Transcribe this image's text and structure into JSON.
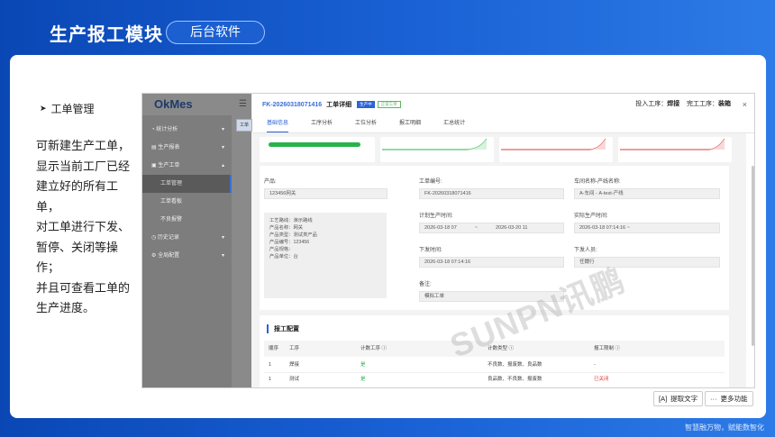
{
  "header": {
    "title": "生产报工模块",
    "pill": "后台软件"
  },
  "footer": "智慧融万物，赋能数智化",
  "section": {
    "heading": "工单管理",
    "desc": [
      "可新建生产工单，",
      "显示当前工厂已经",
      "建立好的所有工单，",
      "对工单进行下发、",
      "暂停、关闭等操作；",
      "并且可查看工单的",
      "生产进度。"
    ]
  },
  "app": {
    "logo": "OkMes",
    "menu_icon": "☰",
    "bg_tab": "工单",
    "sidebar": [
      {
        "label": "统计分析",
        "chevron": "▾"
      },
      {
        "label": "生产报表",
        "chevron": "▾"
      },
      {
        "label": "生产工单",
        "chevron": "▴"
      },
      {
        "label": "工单管理"
      },
      {
        "label": "工单看板"
      },
      {
        "label": "不良报警"
      },
      {
        "label": "历史记录",
        "chevron": "▾"
      },
      {
        "label": "全局配置",
        "chevron": "▾"
      }
    ]
  },
  "modal": {
    "code": "FK-20260318071416",
    "title": "工单详细",
    "badge_a": "生产中",
    "badge_b": "正常工单",
    "input_step_label": "投入工序：",
    "input_step": "焊接",
    "done_step_label": "完工工序：",
    "done_step": "装箱",
    "close": "×",
    "tabs": [
      "基础信息",
      "工序分析",
      "工位分析",
      "报工明细",
      "汇总统计"
    ],
    "product_label": "产品:",
    "product": "123456网关",
    "product_info": [
      "工艺路线：演示路线",
      "产品名称：网关",
      "产品类型：测试类产品",
      "产品编号：123456",
      "产品规格：",
      "产品单位：台"
    ],
    "order_no_label": "工单编号:",
    "order_no": "FK-20260318071416",
    "line_label": "车间名称-产线名称:",
    "line": "A-车间 - A-test-产线",
    "plan_label": "计划生产时间:",
    "plan_start": "2026-03-18 07",
    "plan_sep": "~",
    "plan_end": "2026-03-20 11",
    "actual_label": "实际生产时间:",
    "actual": "2026-03-18 07:14:16 ~",
    "issue_label": "下发时间:",
    "issue": "2026-03-18 07:14:16",
    "issuer_label": "下发人员:",
    "issuer": "任魏行",
    "remark_label": "备注:",
    "remark": "模拟工单",
    "cfg_title": "报工配置",
    "cfg_headers": [
      "顺序",
      "工序",
      "计数工序 ⓘ",
      "计数类型 ⓘ",
      "报工限制 ⓘ"
    ],
    "cfg_rows": [
      [
        "1",
        "焊接",
        "是",
        "不良数、报废数、良品数",
        "-"
      ],
      [
        "1",
        "测试",
        "是",
        "良品数、不良数、报废数",
        "已关闭"
      ]
    ],
    "watermark": "SUNPN讯鹏"
  },
  "toolbar": {
    "extract": "提取文字",
    "extract_icon": "[A]",
    "more": "更多功能",
    "more_icon": "···"
  }
}
